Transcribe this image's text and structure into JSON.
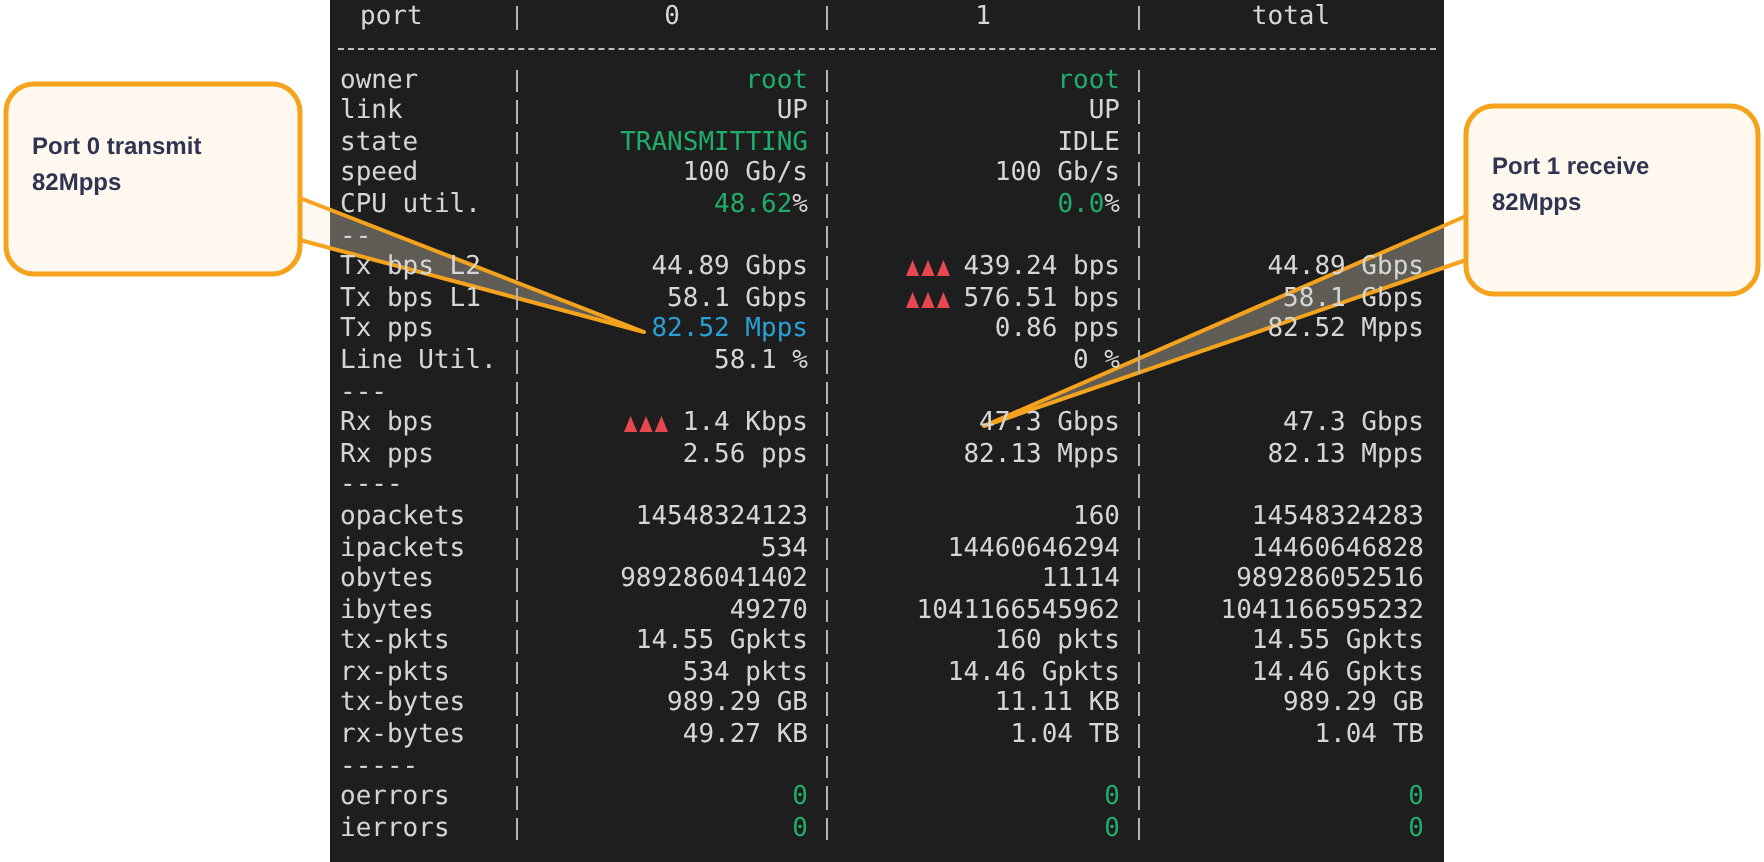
{
  "table": {
    "columns": [
      "port",
      "0",
      "1",
      "total"
    ],
    "rows": [
      {
        "label": "owner",
        "cells": [
          {
            "text": "root",
            "color": "#1fae6a"
          },
          {
            "text": "root",
            "color": "#1fae6a"
          },
          null
        ]
      },
      {
        "label": "link",
        "cells": [
          {
            "text": "UP"
          },
          {
            "text": "UP"
          },
          null
        ]
      },
      {
        "label": "state",
        "cells": [
          {
            "text": "TRANSMITTING",
            "color": "#1fae6a"
          },
          {
            "text": "IDLE"
          },
          null
        ]
      },
      {
        "label": "speed",
        "cells": [
          {
            "text": "100 Gb/s"
          },
          {
            "text": "100 Gb/s"
          },
          null
        ]
      },
      {
        "label": "CPU util.",
        "cells": [
          {
            "text": "48.62",
            "color": "#1fae6a",
            "suffix": "%"
          },
          {
            "text": "0.0",
            "color": "#1fae6a",
            "suffix": "%"
          },
          null
        ]
      },
      {
        "label": "--",
        "cells": [
          null,
          null,
          null
        ]
      },
      {
        "label": "Tx bps L2",
        "cells": [
          {
            "text": "44.89 Gbps"
          },
          {
            "text": "439.24 bps",
            "warning": true
          },
          {
            "text": "44.89 Gbps"
          }
        ]
      },
      {
        "label": "Tx bps L1",
        "cells": [
          {
            "text": "58.1 Gbps"
          },
          {
            "text": "576.51 bps",
            "warning": true
          },
          {
            "text": "58.1 Gbps"
          }
        ]
      },
      {
        "label": "Tx pps",
        "cells": [
          {
            "text": "82.52 Mpps",
            "color": "#2b9fd3"
          },
          {
            "text": "0.86 pps"
          },
          {
            "text": "82.52 Mpps"
          }
        ]
      },
      {
        "label": "Line Util.",
        "cells": [
          {
            "text": "58.1 %"
          },
          {
            "text": "0 %"
          },
          null
        ]
      },
      {
        "label": "---",
        "cells": [
          null,
          null,
          null
        ]
      },
      {
        "label": "Rx bps",
        "cells": [
          {
            "text": "1.4 Kbps",
            "warning": true
          },
          {
            "text": "47.3 Gbps"
          },
          {
            "text": "47.3 Gbps"
          }
        ]
      },
      {
        "label": "Rx pps",
        "cells": [
          {
            "text": "2.56 pps"
          },
          {
            "text": "82.13 Mpps"
          },
          {
            "text": "82.13 Mpps"
          }
        ]
      },
      {
        "label": "----",
        "cells": [
          null,
          null,
          null
        ]
      },
      {
        "label": "opackets",
        "cells": [
          {
            "text": "14548324123"
          },
          {
            "text": "160"
          },
          {
            "text": "14548324283"
          }
        ]
      },
      {
        "label": "ipackets",
        "cells": [
          {
            "text": "534"
          },
          {
            "text": "14460646294"
          },
          {
            "text": "14460646828"
          }
        ]
      },
      {
        "label": "obytes",
        "cells": [
          {
            "text": "989286041402"
          },
          {
            "text": "11114"
          },
          {
            "text": "989286052516"
          }
        ]
      },
      {
        "label": "ibytes",
        "cells": [
          {
            "text": "49270"
          },
          {
            "text": "1041166545962"
          },
          {
            "text": "1041166595232"
          }
        ]
      },
      {
        "label": "tx-pkts",
        "cells": [
          {
            "text": "14.55 Gpkts"
          },
          {
            "text": "160 pkts"
          },
          {
            "text": "14.55 Gpkts"
          }
        ]
      },
      {
        "label": "rx-pkts",
        "cells": [
          {
            "text": "534 pkts"
          },
          {
            "text": "14.46 Gpkts"
          },
          {
            "text": "14.46 Gpkts"
          }
        ]
      },
      {
        "label": "tx-bytes",
        "cells": [
          {
            "text": "989.29 GB"
          },
          {
            "text": "11.11 KB"
          },
          {
            "text": "989.29 GB"
          }
        ]
      },
      {
        "label": "rx-bytes",
        "cells": [
          {
            "text": "49.27 KB"
          },
          {
            "text": "1.04 TB"
          },
          {
            "text": "1.04 TB"
          }
        ]
      },
      {
        "label": "-----",
        "cells": [
          null,
          null,
          null
        ]
      },
      {
        "label": "oerrors",
        "cells": [
          {
            "text": "0",
            "color": "#1fae6a"
          },
          {
            "text": "0",
            "color": "#1fae6a"
          },
          {
            "text": "0",
            "color": "#1fae6a"
          }
        ]
      },
      {
        "label": "ierrors",
        "cells": [
          {
            "text": "0",
            "color": "#1fae6a"
          },
          {
            "text": "0",
            "color": "#1fae6a"
          },
          {
            "text": "0",
            "color": "#1fae6a"
          }
        ]
      }
    ]
  },
  "callouts": [
    {
      "text": "Port 0 transmit 82Mpps"
    },
    {
      "text": "Port 1 receive 82Mpps"
    }
  ]
}
